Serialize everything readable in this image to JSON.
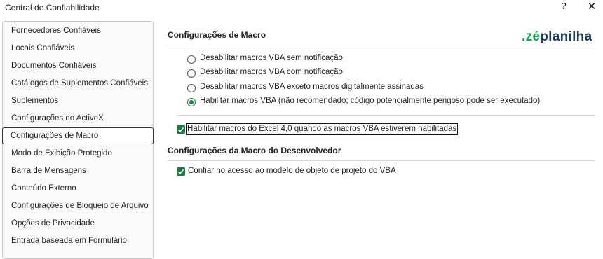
{
  "window": {
    "title": "Central de Confiabilidade",
    "help_label": "?",
    "close_label": "✕"
  },
  "sidebar": {
    "items": [
      {
        "label": "Fornecedores Confiáveis",
        "selected": false
      },
      {
        "label": "Locais Confiáveis",
        "selected": false
      },
      {
        "label": "Documentos Confiáveis",
        "selected": false
      },
      {
        "label": "Catálogos de Suplementos Confiáveis",
        "selected": false
      },
      {
        "label": "Suplementos",
        "selected": false
      },
      {
        "label": "Configurações do ActiveX",
        "selected": false
      },
      {
        "label": "Configurações de Macro",
        "selected": true
      },
      {
        "label": "Modo de Exibição Protegido",
        "selected": false
      },
      {
        "label": "Barra de Mensagens",
        "selected": false
      },
      {
        "label": "Conteúdo Externo",
        "selected": false
      },
      {
        "label": "Configurações de Bloqueio de Arquivo",
        "selected": false
      },
      {
        "label": "Opções de Privacidade",
        "selected": false
      },
      {
        "label": "Entrada baseada em Formulário",
        "selected": false
      }
    ]
  },
  "logo": {
    "dot": ".",
    "ze": "zé",
    "rest": "planilha",
    "colors": {
      "green": "#18a558",
      "navy": "#1c3d5a"
    }
  },
  "macro_settings": {
    "heading": "Configurações de Macro",
    "options": [
      {
        "label": "Desabilitar macros VBA sem notificação",
        "checked": false
      },
      {
        "label": "Desabilitar macros VBA com notificação",
        "checked": false
      },
      {
        "label": "Desabilitar macros VBA exceto macros digitalmente assinadas",
        "checked": false
      },
      {
        "label": "Habilitar macros VBA (não recomendado; código potencialmente perigoso pode ser executado)",
        "checked": true
      }
    ],
    "excel4_checkbox": {
      "label": "Habilitar macros do Excel 4,0 quando as macros VBA estiverem habilitadas",
      "checked": true
    }
  },
  "developer_settings": {
    "heading": "Configurações da Macro do Desenvolvedor",
    "vba_trust_checkbox": {
      "label": "Confiar no acesso ao modelo de objeto de projeto do VBA",
      "checked": true
    }
  },
  "accent_color": "#1e7b40"
}
